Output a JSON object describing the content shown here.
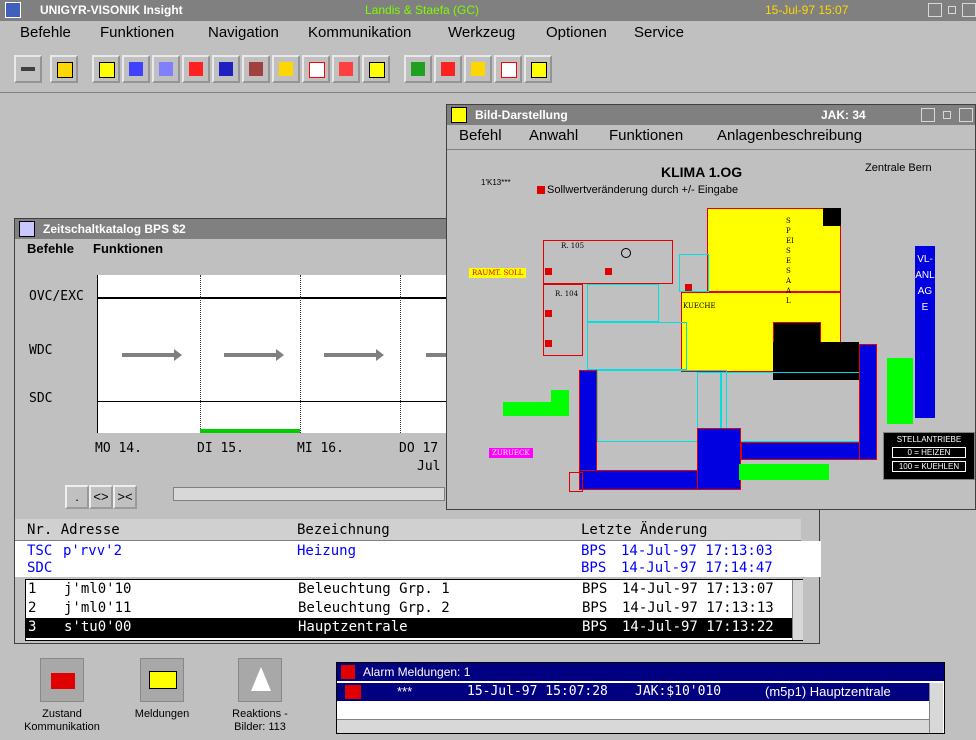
{
  "main": {
    "title": "UNIGYR-VISONIK Insight",
    "center": "Landis & Staefa (GC)",
    "datetime": "15-Jul-97  15:07"
  },
  "menu": [
    "Befehle",
    "Funktionen",
    "Navigation",
    "Kommunikation",
    "Werkzeug",
    "Optionen",
    "Service"
  ],
  "toolbar_icons": [
    "key-icon",
    "lock-icon",
    "plan-icon",
    "trend-icon",
    "catalog-icon",
    "link-icon",
    "bar-chart-icon",
    "building-icon",
    "bell-icon",
    "curve-icon",
    "alarm-icon",
    "message-icon",
    "plan-icon",
    "link-icon",
    "bell-icon",
    "curve-icon",
    "status-icon"
  ],
  "zeitschalt": {
    "title": "Zeitschaltkatalog BPS $2",
    "menu": [
      "Befehle",
      "Funktionen"
    ],
    "rows": [
      "OVC/EXC",
      "WDC",
      "SDC"
    ],
    "days": [
      "MO 14.",
      "DI 15.",
      "MI 16.",
      "DO 17"
    ],
    "month": "Jul",
    "buttons": [
      ".",
      "<>",
      "><"
    ]
  },
  "table": {
    "headers": [
      "Nr. Adresse",
      "Bezeichnung",
      "Letzte Änderung"
    ],
    "top_rows": [
      {
        "nr": "TSC",
        "addr": "p'rvv'2",
        "name": "Heizung",
        "who": "BPS",
        "date": "14-Jul-97 17:13:03"
      },
      {
        "nr": "SDC",
        "addr": "",
        "name": "",
        "who": "BPS",
        "date": "14-Jul-97 17:14:47"
      }
    ],
    "rows": [
      {
        "nr": "1",
        "addr": "j'ml0'10",
        "name": "Beleuchtung Grp. 1",
        "who": "BPS",
        "date": "14-Jul-97 17:13:07"
      },
      {
        "nr": "2",
        "addr": "j'ml0'11",
        "name": "Beleuchtung Grp. 2",
        "who": "BPS",
        "date": "14-Jul-97 17:13:13"
      },
      {
        "nr": "3",
        "addr": "s'tu0'00",
        "name": "Hauptzentrale",
        "who": "BPS",
        "date": "14-Jul-97 17:13:22"
      }
    ]
  },
  "bild": {
    "title": "Bild-Darstellung",
    "jak": "JAK: 34",
    "menu": [
      "Befehl",
      "Anwahl",
      "Funktionen",
      "Anlagenbeschreibung"
    ],
    "heading": "KLIMA 1.OG",
    "zentrale": "Zentrale Bern",
    "code": "1'K13***",
    "legend": "Sollwertveränderung durch +/- Eingabe",
    "room_105": "R. 105",
    "room_104": "R. 104",
    "raumt": "RAUMT. SOLL",
    "speisesaal": "SPEISESAAL",
    "kueche": "KUECHE",
    "zurueck": "ZURUECK",
    "vl_anlage": "VL-ANLAGE",
    "stell_title": "STELLANTRIEBE",
    "stell_0": "0 = HEIZEN",
    "stell_100": "100 = KUEHLEN"
  },
  "desktop_icons": [
    {
      "label1": "Zustand",
      "label2": "Kommunikation"
    },
    {
      "label1": "Meldungen",
      "label2": ""
    },
    {
      "label1": "Reaktions -",
      "label2": "Bilder: 113"
    }
  ],
  "alarm": {
    "title": "Alarm Meldungen: 1",
    "stars": "***",
    "time": "15-Jul-97 15:07:28",
    "jak": "JAK:$10'010",
    "text": "(m5p1) Hauptzentrale"
  }
}
